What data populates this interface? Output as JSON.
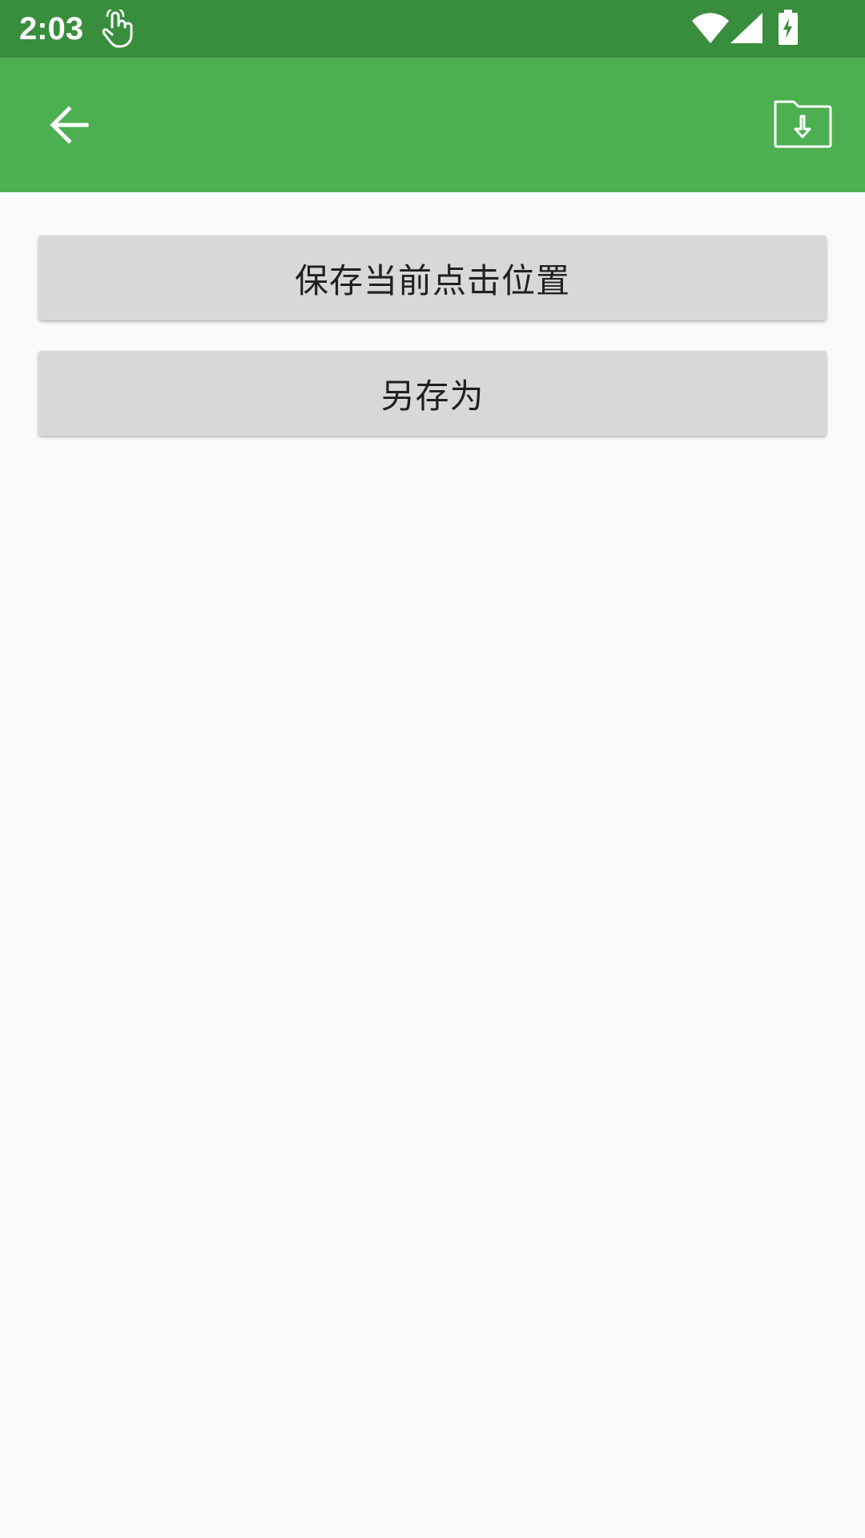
{
  "status_bar": {
    "time": "2:03",
    "icons": [
      "touch-icon",
      "wifi-icon",
      "signal-icon",
      "battery-charging-icon"
    ]
  },
  "app_bar": {
    "back_icon": "arrow-back-icon",
    "action_icon": "folder-download-icon",
    "background": "#4CAF50",
    "status_background": "#388E3C"
  },
  "main": {
    "buttons": [
      {
        "label": "保存当前点击位置"
      },
      {
        "label": "另存为"
      }
    ]
  }
}
